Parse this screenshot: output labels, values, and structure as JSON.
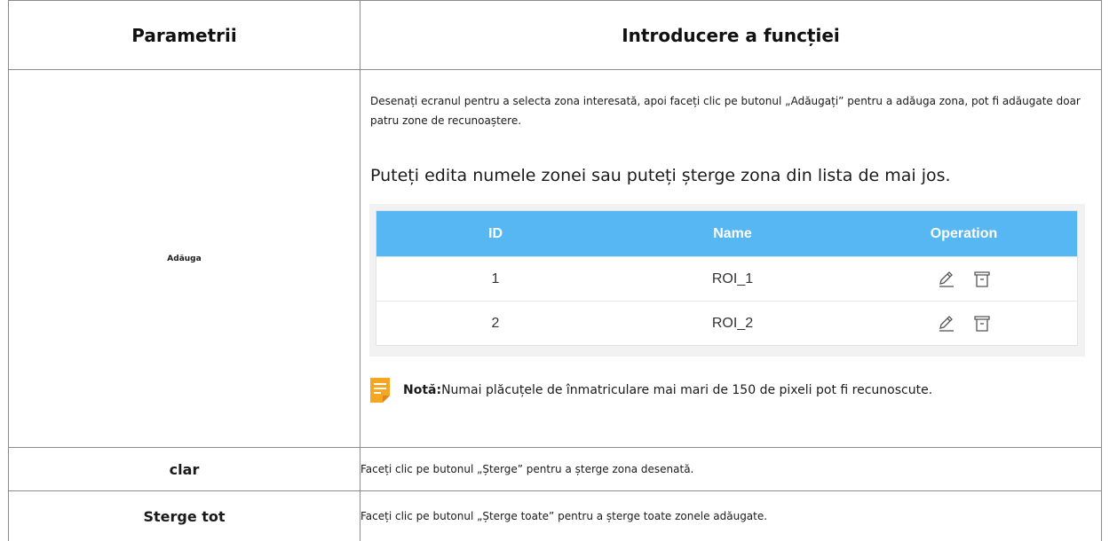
{
  "table": {
    "headers": {
      "param": "Parametrii",
      "intro": "Introducere a funcției"
    }
  },
  "add": {
    "param": "Adăuga",
    "para1": "Desenați ecranul pentru a selecta zona interesată, apoi faceți clic pe butonul „Adăugați” pentru a adăuga zona, pot fi adăugate doar patru zone de recunoaștere.",
    "para2": "Puteți edita numele zonei sau puteți șterge zona din lista de mai jos.",
    "roi_table": {
      "headers": {
        "id": "ID",
        "name": "Name",
        "operation": "Operation"
      },
      "rows": [
        {
          "id": "1",
          "name": "ROI_1"
        },
        {
          "id": "2",
          "name": "ROI_2"
        }
      ],
      "header_color": "#57b7f3"
    },
    "note": {
      "label": "Notă:",
      "text": "Numai plăcuțele de înmatriculare mai mari de 150 de pixeli pot fi recunoscute.",
      "icon": "note-icon",
      "icon_color": "#f5a623"
    }
  },
  "clear": {
    "param": "clar",
    "desc": "Faceți clic pe butonul „Șterge” pentru a șterge zona desenată."
  },
  "clear_all": {
    "param": "Sterge tot",
    "desc": "Faceți clic pe butonul „Șterge toate” pentru a șterge toate zonele adăugate."
  }
}
